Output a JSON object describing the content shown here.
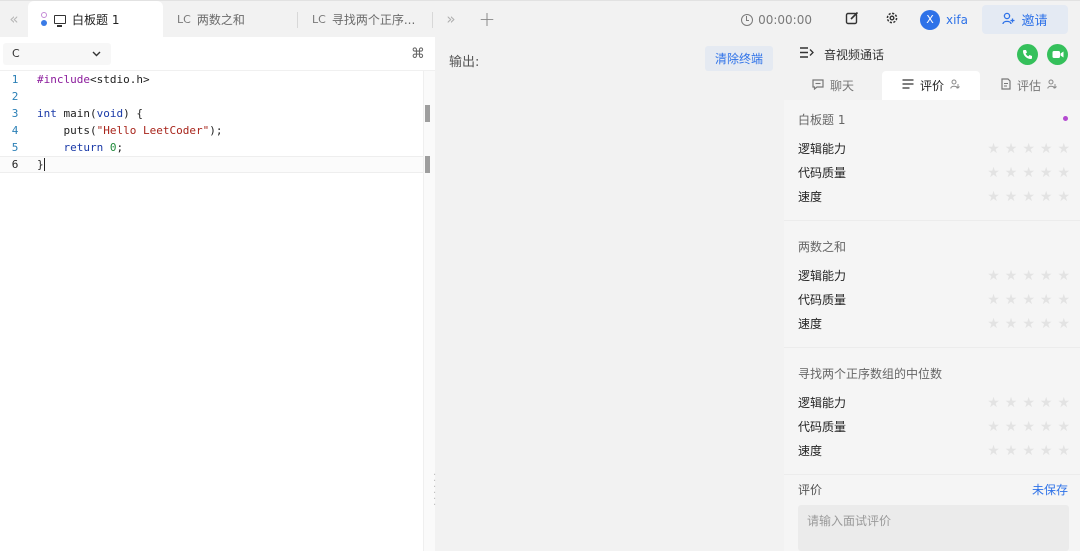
{
  "topbar": {
    "tabs": [
      {
        "prefix": "",
        "label": "白板题 1"
      },
      {
        "prefix": "LC",
        "label": "两数之和"
      },
      {
        "prefix": "LC",
        "label": "寻找两个正序..."
      }
    ],
    "timer": "00:00:00",
    "user": {
      "initial": "X",
      "name": "xifa"
    },
    "invite_label": "邀请"
  },
  "editor": {
    "language": "C",
    "code_lines": [
      {
        "num": "1",
        "text": "#include<stdio.h>"
      },
      {
        "num": "2",
        "text": ""
      },
      {
        "num": "3",
        "text": "int main(void) {"
      },
      {
        "num": "4",
        "text": "    puts(\"Hello LeetCoder\");"
      },
      {
        "num": "5",
        "text": "    return 0;"
      },
      {
        "num": "6",
        "text": "}"
      }
    ]
  },
  "output": {
    "label": "输出:",
    "clear_label": "清除终端"
  },
  "panel": {
    "call_title": "音视频通话",
    "tabs": [
      {
        "label": "聊天"
      },
      {
        "label": "评价"
      },
      {
        "label": "评估"
      }
    ],
    "sections": [
      {
        "title": "白板题 1",
        "criteria": [
          "逻辑能力",
          "代码质量",
          "速度"
        ]
      },
      {
        "title": "两数之和",
        "criteria": [
          "逻辑能力",
          "代码质量",
          "速度"
        ]
      },
      {
        "title": "寻找两个正序数组的中位数",
        "criteria": [
          "逻辑能力",
          "代码质量",
          "速度"
        ]
      }
    ],
    "comment_label": "评价",
    "unsaved_label": "未保存",
    "comment_placeholder": "请输入面试评价",
    "accent_color": "#2e72e8",
    "call_color": "#35c05b"
  }
}
